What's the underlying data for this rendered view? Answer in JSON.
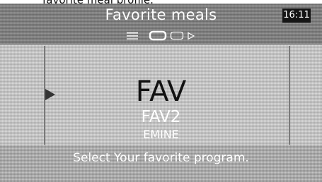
{
  "caption": "favorite meal profile.",
  "header": {
    "title": "Favorite meals",
    "clock": "16:11",
    "icons": [
      "menu-icon",
      "oven-icon",
      "tray-icon",
      "play-icon"
    ]
  },
  "selector": {
    "selected": "FAV",
    "next_1": "FAV2",
    "next_2": "EMINE"
  },
  "hint": "Select Your favorite program."
}
